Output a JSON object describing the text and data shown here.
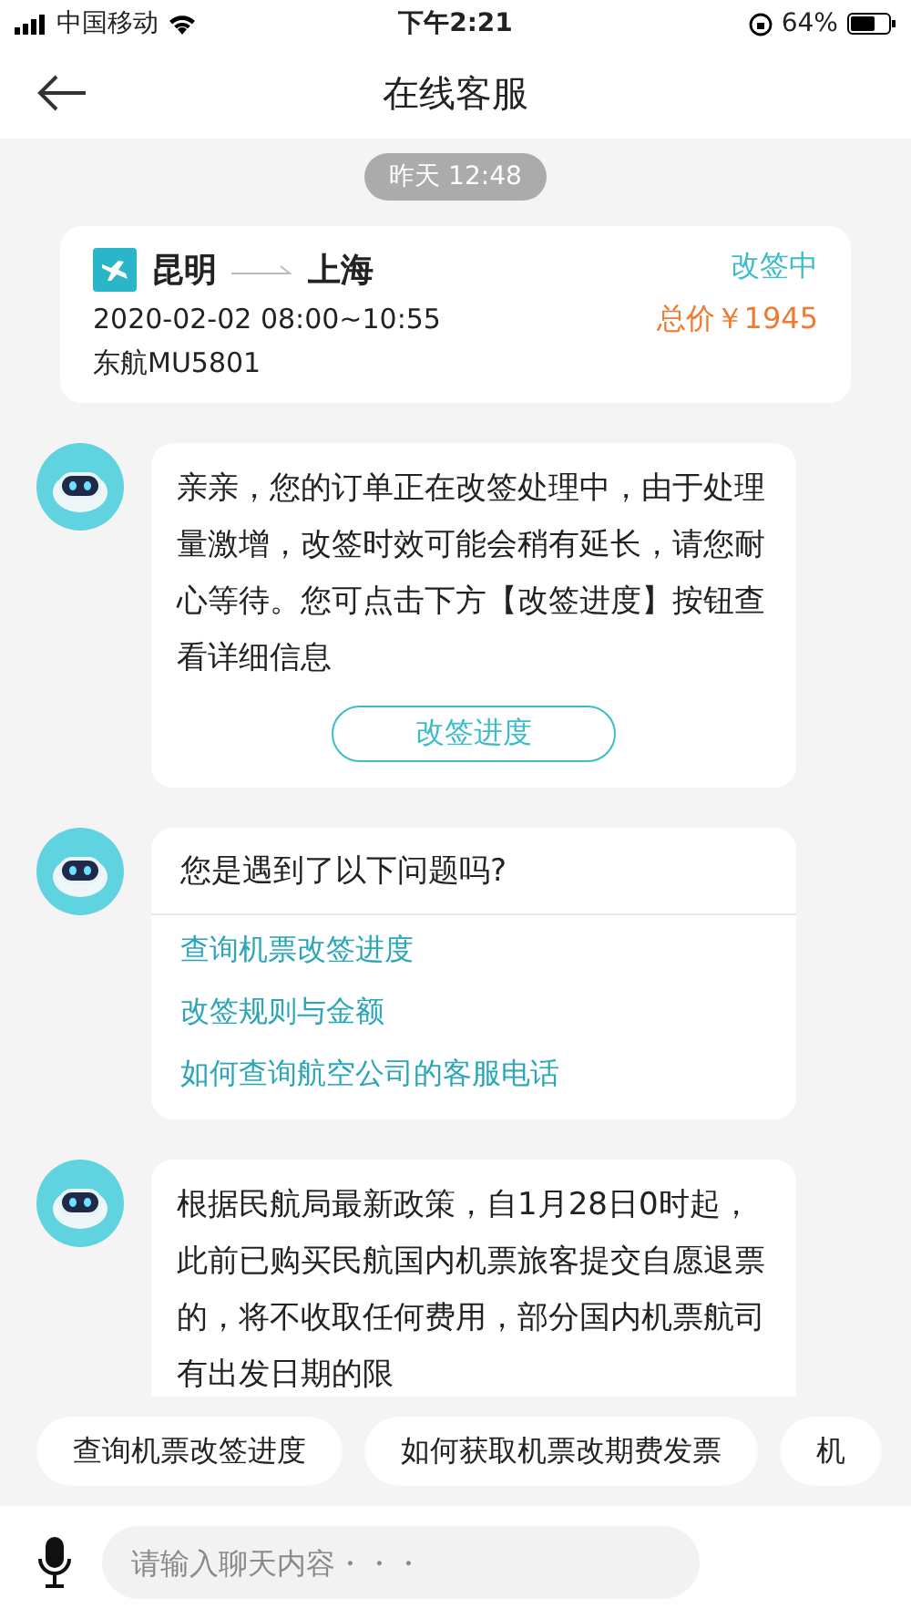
{
  "status_bar": {
    "carrier": "中国移动",
    "time": "下午2:21",
    "battery": "64%"
  },
  "nav": {
    "title": "在线客服"
  },
  "timestamp": "昨天 12:48",
  "order_card": {
    "from": "昆明",
    "to": "上海",
    "status": "改签中",
    "datetime": "2020-02-02 08:00~10:55",
    "price": "总价￥1945",
    "flight": "东航MU5801"
  },
  "messages": [
    {
      "kind": "text",
      "text": "亲亲，您的订单正在改签处理中，由于处理量激增，改签时效可能会稍有延长，请您耐心等待。您可点击下方【改签进度】按钮查看详细信息",
      "button": "改签进度"
    },
    {
      "kind": "questions",
      "title": "您是遇到了以下问题吗?",
      "links": [
        "查询机票改签进度",
        "改签规则与金额",
        "如何查询航空公司的客服电话"
      ]
    },
    {
      "kind": "text",
      "text": "根据民航局最新政策，自1月28日0时起，此前已购买民航国内机票旅客提交自愿退票的，将不收取任何费用，部分国内机票航司有出发日期的限"
    }
  ],
  "quick_replies": [
    "查询机票改签进度",
    "如何获取机票改期费发票",
    "机"
  ],
  "input": {
    "placeholder": "请输入聊天内容・・・"
  }
}
